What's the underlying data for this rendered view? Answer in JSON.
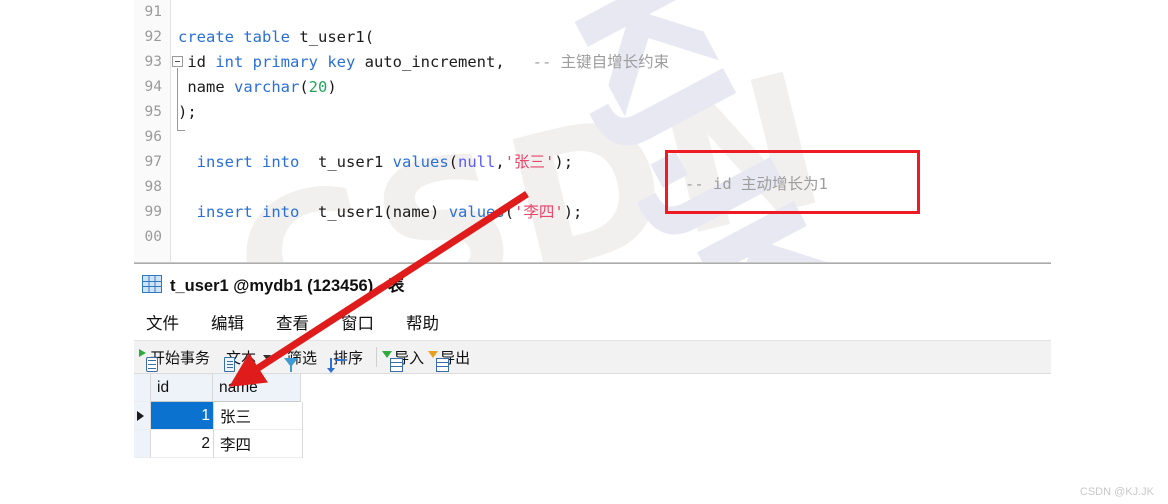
{
  "watermarks": {
    "diagonal": "KJ.JK",
    "faint_csdn": "CSDN",
    "credit": "CSDN @KJ.JK"
  },
  "editor": {
    "lines": [
      {
        "num": "91",
        "segments": []
      },
      {
        "num": "92",
        "segments": [
          {
            "t": "create",
            "c": "kw"
          },
          {
            "t": " ",
            "c": "plain"
          },
          {
            "t": "table",
            "c": "kw"
          },
          {
            "t": " ",
            "c": "plain"
          },
          {
            "t": "t_user1",
            "c": "plain"
          },
          {
            "t": "(",
            "c": "punc"
          }
        ]
      },
      {
        "num": "93",
        "segments": [
          {
            "t": " id ",
            "c": "plain"
          },
          {
            "t": "int",
            "c": "kw"
          },
          {
            "t": " ",
            "c": "plain"
          },
          {
            "t": "primary",
            "c": "kw"
          },
          {
            "t": " ",
            "c": "plain"
          },
          {
            "t": "key",
            "c": "kw"
          },
          {
            "t": " auto_increment",
            "c": "plain"
          },
          {
            "t": ",",
            "c": "punc"
          },
          {
            "t": "   -- 主键自增长约束",
            "c": "cmt"
          }
        ]
      },
      {
        "num": "94",
        "segments": [
          {
            "t": " name ",
            "c": "plain"
          },
          {
            "t": "varchar",
            "c": "kw"
          },
          {
            "t": "(",
            "c": "punc"
          },
          {
            "t": "20",
            "c": "num"
          },
          {
            "t": ")",
            "c": "punc"
          }
        ]
      },
      {
        "num": "95",
        "segments": [
          {
            "t": ");",
            "c": "punc"
          }
        ]
      },
      {
        "num": "96",
        "segments": []
      },
      {
        "num": "97",
        "segments": [
          {
            "t": "  ",
            "c": "plain"
          },
          {
            "t": "insert",
            "c": "kw"
          },
          {
            "t": " ",
            "c": "plain"
          },
          {
            "t": "into",
            "c": "kw"
          },
          {
            "t": "  t_user1 ",
            "c": "plain"
          },
          {
            "t": "values",
            "c": "kw"
          },
          {
            "t": "(",
            "c": "punc"
          },
          {
            "t": "null",
            "c": "opr"
          },
          {
            "t": ",",
            "c": "punc"
          },
          {
            "t": "'张三'",
            "c": "str"
          },
          {
            "t": ");",
            "c": "punc"
          }
        ]
      },
      {
        "num": "98",
        "segments": []
      },
      {
        "num": "99",
        "segments": [
          {
            "t": "  ",
            "c": "plain"
          },
          {
            "t": "insert",
            "c": "kw"
          },
          {
            "t": " ",
            "c": "plain"
          },
          {
            "t": "into",
            "c": "kw"
          },
          {
            "t": "  t_user1",
            "c": "plain"
          },
          {
            "t": "(",
            "c": "punc"
          },
          {
            "t": "name",
            "c": "plain"
          },
          {
            "t": ")",
            "c": "punc"
          },
          {
            "t": " ",
            "c": "plain"
          },
          {
            "t": "values",
            "c": "kw"
          },
          {
            "t": "(",
            "c": "punc"
          },
          {
            "t": "'李四'",
            "c": "str"
          },
          {
            "t": ");",
            "c": "punc"
          }
        ]
      },
      {
        "num": "00",
        "segments": []
      }
    ],
    "fold_widget": "collapse-fold-icon"
  },
  "annotation": {
    "box_color": "#ee1b24",
    "arrow_color": "#e01b1b",
    "boxed_comment": "-- id 主动增长为1"
  },
  "table_window": {
    "title": "t_user1 @mydb1 (123456) - 表",
    "title_icon": "table-grid-icon",
    "menu": [
      {
        "label": "文件"
      },
      {
        "label": "编辑"
      },
      {
        "label": "查看"
      },
      {
        "label": "窗口"
      },
      {
        "label": "帮助"
      }
    ],
    "toolbar": [
      {
        "label": "开始事务",
        "icon": "begin-transaction-icon"
      },
      {
        "label": "文本",
        "icon": "text-document-icon",
        "has_caret": true
      },
      {
        "label": "筛选",
        "icon": "filter-funnel-icon"
      },
      {
        "label": "排序",
        "icon": "sort-icon"
      },
      {
        "label": "导入",
        "icon": "import-icon"
      },
      {
        "label": "导出",
        "icon": "export-icon"
      }
    ],
    "grid": {
      "columns": [
        "id",
        "name"
      ],
      "rows": [
        {
          "id": "1",
          "name": "张三",
          "selected": true
        },
        {
          "id": "2",
          "name": "李四",
          "selected": false
        }
      ]
    }
  }
}
